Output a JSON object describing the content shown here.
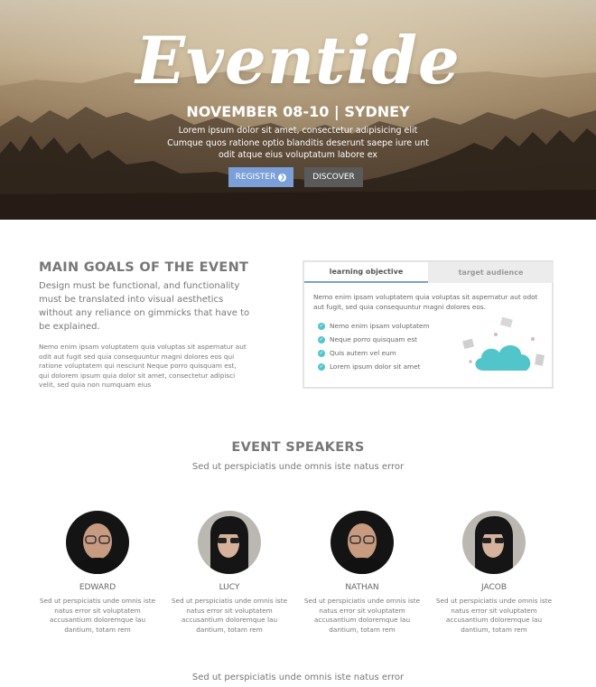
{
  "hero": {
    "logo": "Eventide",
    "date": "NOVEMBER 08-10 | SYDNEY",
    "text": "Lorem ipsum dolor sit amet, consectetur adipisicing elit Cumque quos ratione optio blanditis deserunt saepe iure unt odit atque eius voluptatum labore ex",
    "register_label": "REGISTER",
    "discover_label": "DISCOVER"
  },
  "goals": {
    "title": "MAIN GOALS OF THE EVENT",
    "lead": "Design must be functional, and functionality must be translated into visual aesthetics without any reliance on gimmicks that have to be explained.",
    "body": "Nemo enim ipsam voluptatem quia voluptas sit aspernatur aut odit aut fugit sed quia consequuntur magni dolores eos qui ratione voluptatem qui nesciunt Neque porro quisquam est, qui dolorem ipsum quia dolor sit amet, consectetur adipisci velit, sed quia non numquam eius"
  },
  "tabs": {
    "items": [
      "learning objective",
      "target audience"
    ],
    "active": "learning objective",
    "content_text": "Nemo enim ipsam voluptatem quia voluptas sit aspernatur aut odot aut fugit, sed quia consequuntur magni dolores eos.",
    "checklist": [
      "Nemo enim ipsam voluptatem",
      "Neque porro quisquam est",
      "Quis autem vel eum",
      "Lorem ipsum dolor sit amet"
    ]
  },
  "speakers": {
    "title": "EVENT SPEAKERS",
    "subtitle": "Sed ut perspiciatis unde omnis iste natus error",
    "items": [
      {
        "name": "EDWARD",
        "description": "Sed ut perspiciatis unde omnis iste natus error sit voluptatem accusantium doloremque lau dantium, totam rem"
      },
      {
        "name": "LUCY",
        "description": "Sed ut perspiciatis unde omnis iste natus error sit voluptatem accusantium doloremque lau dantium, totam rem"
      },
      {
        "name": "NATHAN",
        "description": "Sed ut perspiciatis unde omnis iste natus error sit voluptatem accusantium doloremque lau dantium, totam rem"
      },
      {
        "name": "JACOB",
        "description": "Sed ut perspiciatis unde omnis iste natus error sit voluptatem accusantium doloremque lau dantium, totam rem"
      }
    ]
  },
  "footer": {
    "subtitle": "Sed ut perspiciatis unde omnis iste natus error"
  },
  "icons": {
    "arrow": "arrow-right-circle-icon",
    "check": "check-circle-icon",
    "cloud": "cloud-illustration"
  },
  "colors": {
    "accent_blue": "#7b9fd9",
    "button_dark": "#5a5a5a",
    "teal": "#52c5cb"
  }
}
